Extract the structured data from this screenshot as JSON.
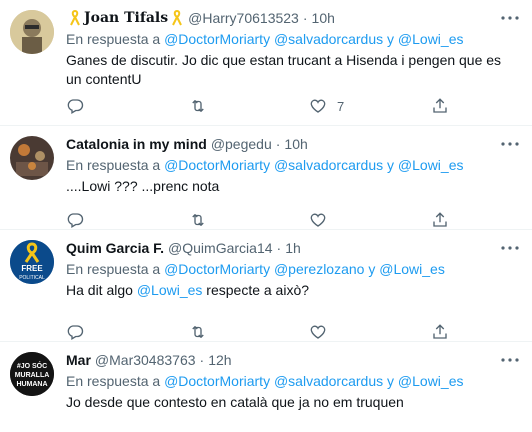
{
  "colors": {
    "accent": "#1d9bf0",
    "muted": "#536471",
    "text": "#0f1419",
    "ribbon": "#f5c518"
  },
  "reply_prefix": "En respuesta a",
  "tweets": [
    {
      "name": "Joan Tifals",
      "handle": "@Harry70613523",
      "time": "10h",
      "has_ribbons": true,
      "reply_mentions": [
        "@DoctorMoriarty",
        "@salvadorcardus",
        "@Lowi_es"
      ],
      "conjunction": "y",
      "text": "Ganes de discutir. Jo dic que estan trucant a Hisenda i pengen que es un contentU",
      "like_count": "7"
    },
    {
      "name": "Catalonia in my mind",
      "handle": "@pegedu",
      "time": "10h",
      "reply_mentions": [
        "@DoctorMoriarty",
        "@salvadorcardus",
        "@Lowi_es"
      ],
      "conjunction": "y",
      "text": "....Lowi ??? ...prenc nota",
      "like_count": ""
    },
    {
      "name": "Quim Garcia F.",
      "handle": "@QuimGarcia14",
      "time": "1h",
      "reply_mentions": [
        "@DoctorMoriarty",
        "@perezlozano",
        "@Lowi_es"
      ],
      "conjunction": "y",
      "text_before": "Ha dit algo",
      "text_mention": "@Lowi_es",
      "text_after": "respecte a això?",
      "avatar_text": "FREE POLITICAL",
      "like_count": ""
    },
    {
      "name": "Mar",
      "handle": "@Mar30483763",
      "time": "12h",
      "reply_mentions": [
        "@DoctorMoriarty",
        "@salvadorcardus",
        "@Lowi_es"
      ],
      "conjunction": "y",
      "text": "Jo desde que contesto en català que ja no em truquen",
      "avatar_text": "#JO SÓC MURALLA HUMANA",
      "like_count": ""
    }
  ]
}
